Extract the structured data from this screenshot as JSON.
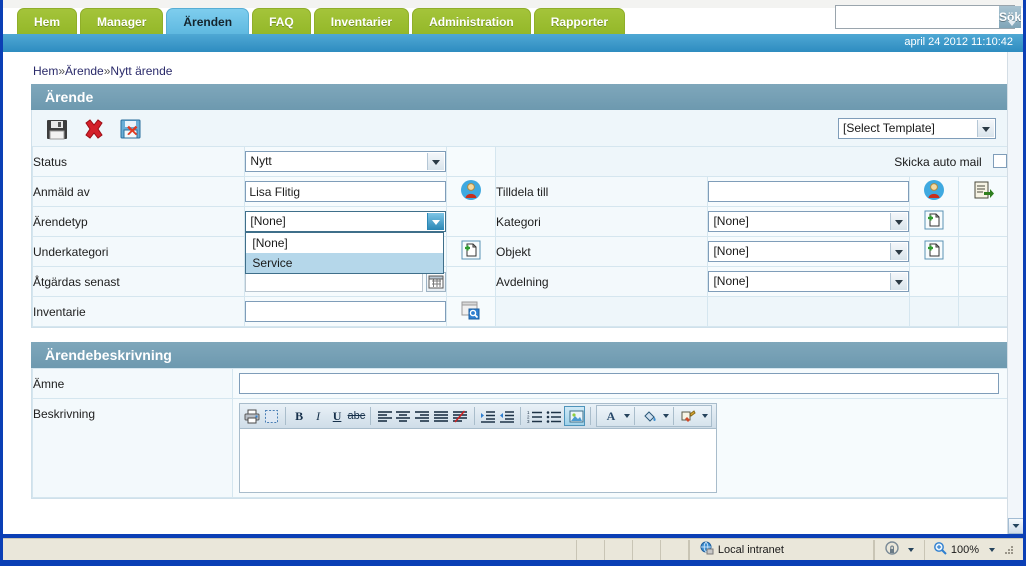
{
  "nav": {
    "tabs": [
      {
        "label": "Hem",
        "active": false
      },
      {
        "label": "Manager",
        "active": false
      },
      {
        "label": "Ärenden",
        "active": true
      },
      {
        "label": "FAQ",
        "active": false
      },
      {
        "label": "Inventarier",
        "active": false
      },
      {
        "label": "Administration",
        "active": false
      },
      {
        "label": "Rapporter",
        "active": false
      }
    ],
    "search": {
      "value": "",
      "placeholder": "",
      "button_label": "Sök"
    }
  },
  "datebar": {
    "datetime": "april 24 2012 11:10:42"
  },
  "breadcrumb": {
    "items": [
      "Hem",
      "Ärende",
      "Nytt ärende"
    ],
    "separator": "»"
  },
  "case_section": {
    "title": "Ärende",
    "toolbar": {
      "save": "save-icon",
      "delete": "delete-icon",
      "save_close": "save-close-icon"
    },
    "template_select": {
      "value": "[Select Template]"
    },
    "auto_mail": {
      "label": "Skicka auto mail",
      "checked": false
    },
    "fields": {
      "status": {
        "label": "Status",
        "value": "Nytt"
      },
      "anmald_av": {
        "label": "Anmäld av",
        "value": "Lisa Flitig"
      },
      "arendetyp": {
        "label": "Ärendetyp",
        "value": "[None]",
        "open": true,
        "options": [
          "[None]",
          "Service"
        ],
        "highlighted": "Service"
      },
      "underkategori": {
        "label": "Underkategori",
        "value": ""
      },
      "atgardas_senast": {
        "label": "Åtgärdas senast",
        "value": ""
      },
      "inventarie": {
        "label": "Inventarie",
        "value": ""
      },
      "tilldela_till": {
        "label": "Tilldela till",
        "value": ""
      },
      "kategori": {
        "label": "Kategori",
        "value": "[None]"
      },
      "objekt": {
        "label": "Objekt",
        "value": "[None]"
      },
      "avdelning": {
        "label": "Avdelning",
        "value": "[None]"
      }
    }
  },
  "description_section": {
    "title": "Ärendebeskrivning",
    "subject": {
      "label": "Ämne",
      "value": ""
    },
    "body": {
      "label": "Beskrivning",
      "value": ""
    },
    "editor_toolbar": [
      "print-icon",
      "select-all-icon",
      "bold-icon",
      "italic-icon",
      "underline-icon",
      "strikethrough-icon",
      "align-left-icon",
      "align-center-icon",
      "align-right-icon",
      "align-justify-icon",
      "remove-format-icon",
      "indent-icon",
      "outdent-icon",
      "numbered-list-icon",
      "bullet-list-icon",
      "insert-image-icon",
      "font-color-icon",
      "fill-color-icon",
      "format-painter-icon"
    ]
  },
  "statusbar": {
    "zone_label": "Local intranet",
    "zone_icon": "globe-icon",
    "security_icon": "privacy-icon",
    "zoom_label": "100%",
    "zoom_icon": "magnifier-icon"
  },
  "colors": {
    "tab_green": "#9bbd2f",
    "tab_active_blue": "#6cc4e8",
    "date_bar_blue": "#3b95c8",
    "section_header": "#6f9bb1",
    "panel_bg": "#eef6fa",
    "highlight": "#b5d7ea",
    "window_frame": "#0b3fb5"
  }
}
